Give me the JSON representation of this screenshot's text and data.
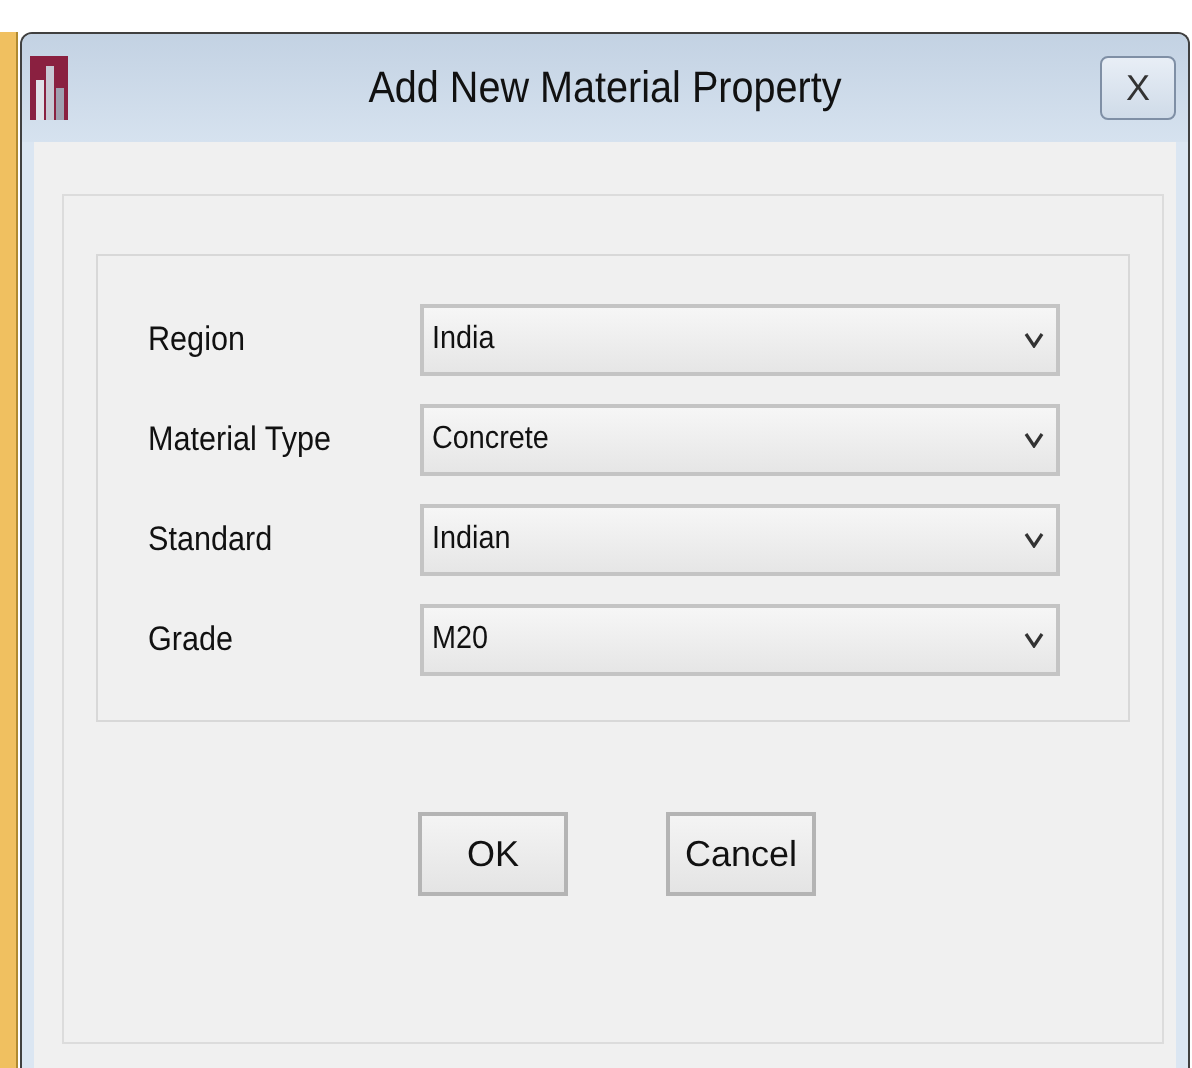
{
  "window": {
    "title": "Add New Material Property",
    "close": "X"
  },
  "fields": [
    {
      "label": "Region",
      "value": "India"
    },
    {
      "label": "Material Type",
      "value": "Concrete"
    },
    {
      "label": "Standard",
      "value": "Indian"
    },
    {
      "label": "Grade",
      "value": "M20"
    }
  ],
  "buttons": [
    "OK",
    "Cancel"
  ]
}
